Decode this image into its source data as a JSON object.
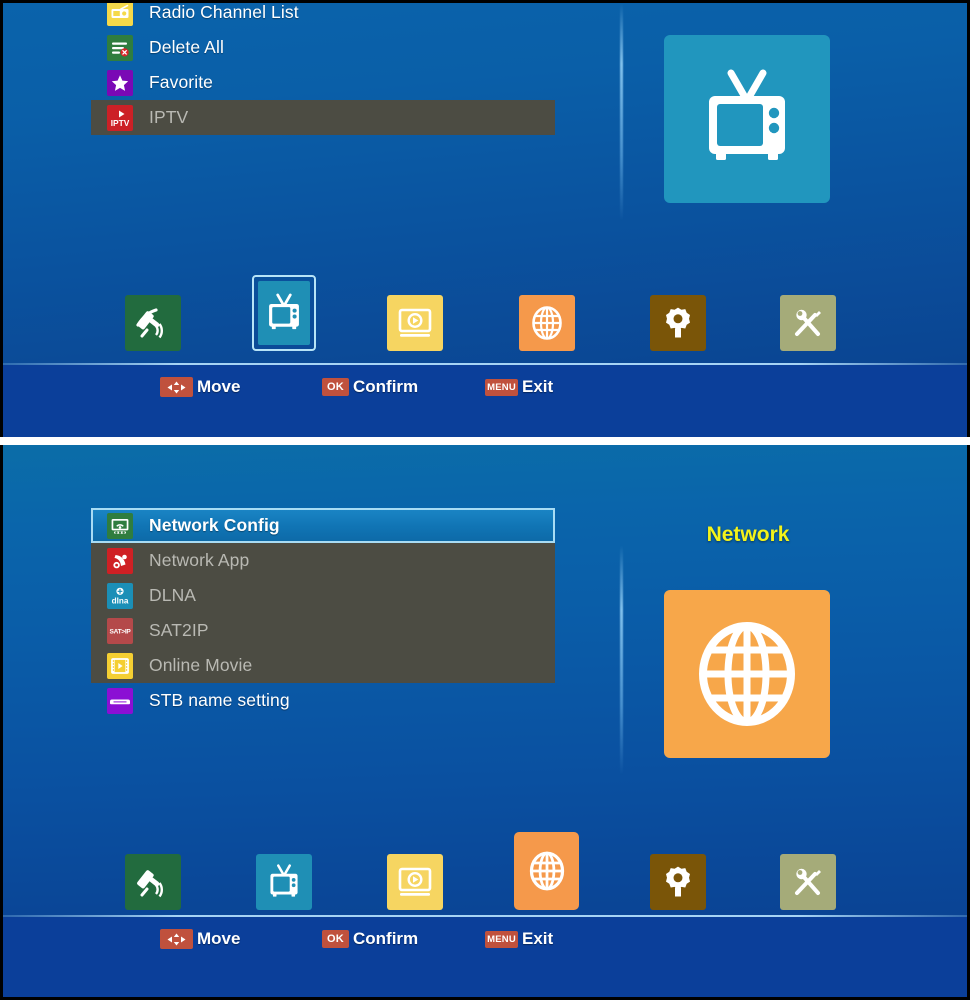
{
  "panels": [
    {
      "id": "channel-panel",
      "preview": {
        "title": "",
        "icon": "tv-icon",
        "bg_color": "#2196be"
      },
      "menu": [
        {
          "label": "Radio Channel List",
          "icon": "radio-icon",
          "state": "normal"
        },
        {
          "label": "Delete All",
          "icon": "delete-all-icon",
          "state": "normal"
        },
        {
          "label": "Favorite",
          "icon": "star-icon",
          "state": "normal"
        },
        {
          "label": "IPTV",
          "icon": "iptv-icon",
          "state": "disabled"
        }
      ],
      "dock": [
        {
          "name": "satellite",
          "icon": "satellite-icon",
          "color": "#226b3e",
          "selected": false
        },
        {
          "name": "tv",
          "icon": "tv-icon",
          "color": "#1f8fb5",
          "selected": true
        },
        {
          "name": "media-player",
          "icon": "media-icon",
          "color": "#f6d561",
          "selected": false
        },
        {
          "name": "network",
          "icon": "globe-icon",
          "color": "#f5994b",
          "selected": false
        },
        {
          "name": "settings",
          "icon": "gear-icon",
          "color": "#7a5508",
          "selected": false
        },
        {
          "name": "tools",
          "icon": "tools-icon",
          "color": "#a5ab79",
          "selected": false
        }
      ],
      "footer": [
        {
          "key": "dpad",
          "key_label": "",
          "label": "Move"
        },
        {
          "key": "ok",
          "key_label": "OK",
          "label": "Confirm"
        },
        {
          "key": "menu",
          "key_label": "MENU",
          "label": "Exit"
        }
      ]
    },
    {
      "id": "network-panel",
      "preview": {
        "title": "Network",
        "icon": "globe-icon",
        "bg_color": "#f7a74a"
      },
      "menu": [
        {
          "label": "Network Config",
          "icon": "network-config-icon",
          "state": "selected"
        },
        {
          "label": "Network App",
          "icon": "network-app-icon",
          "state": "disabled"
        },
        {
          "label": "DLNA",
          "icon": "dlna-icon",
          "state": "disabled"
        },
        {
          "label": "SAT2IP",
          "icon": "sat2ip-icon",
          "state": "disabled"
        },
        {
          "label": "Online Movie",
          "icon": "online-movie-icon",
          "state": "disabled"
        },
        {
          "label": "STB name setting",
          "icon": "stb-icon",
          "state": "normal"
        }
      ],
      "dock": [
        {
          "name": "satellite",
          "icon": "satellite-icon",
          "color": "#226b3e",
          "selected": false
        },
        {
          "name": "tv",
          "icon": "tv-icon",
          "color": "#1f8fb5",
          "selected": false
        },
        {
          "name": "media-player",
          "icon": "media-icon",
          "color": "#f6d561",
          "selected": false
        },
        {
          "name": "network",
          "icon": "globe-icon",
          "color": "#f5994b",
          "selected": true
        },
        {
          "name": "settings",
          "icon": "gear-icon",
          "color": "#7a5508",
          "selected": false
        },
        {
          "name": "tools",
          "icon": "tools-icon",
          "color": "#a5ab79",
          "selected": false
        }
      ],
      "footer": [
        {
          "key": "dpad",
          "key_label": "",
          "label": "Move"
        },
        {
          "key": "ok",
          "key_label": "OK",
          "label": "Confirm"
        },
        {
          "key": "menu",
          "key_label": "MENU",
          "label": "Exit"
        }
      ]
    }
  ]
}
